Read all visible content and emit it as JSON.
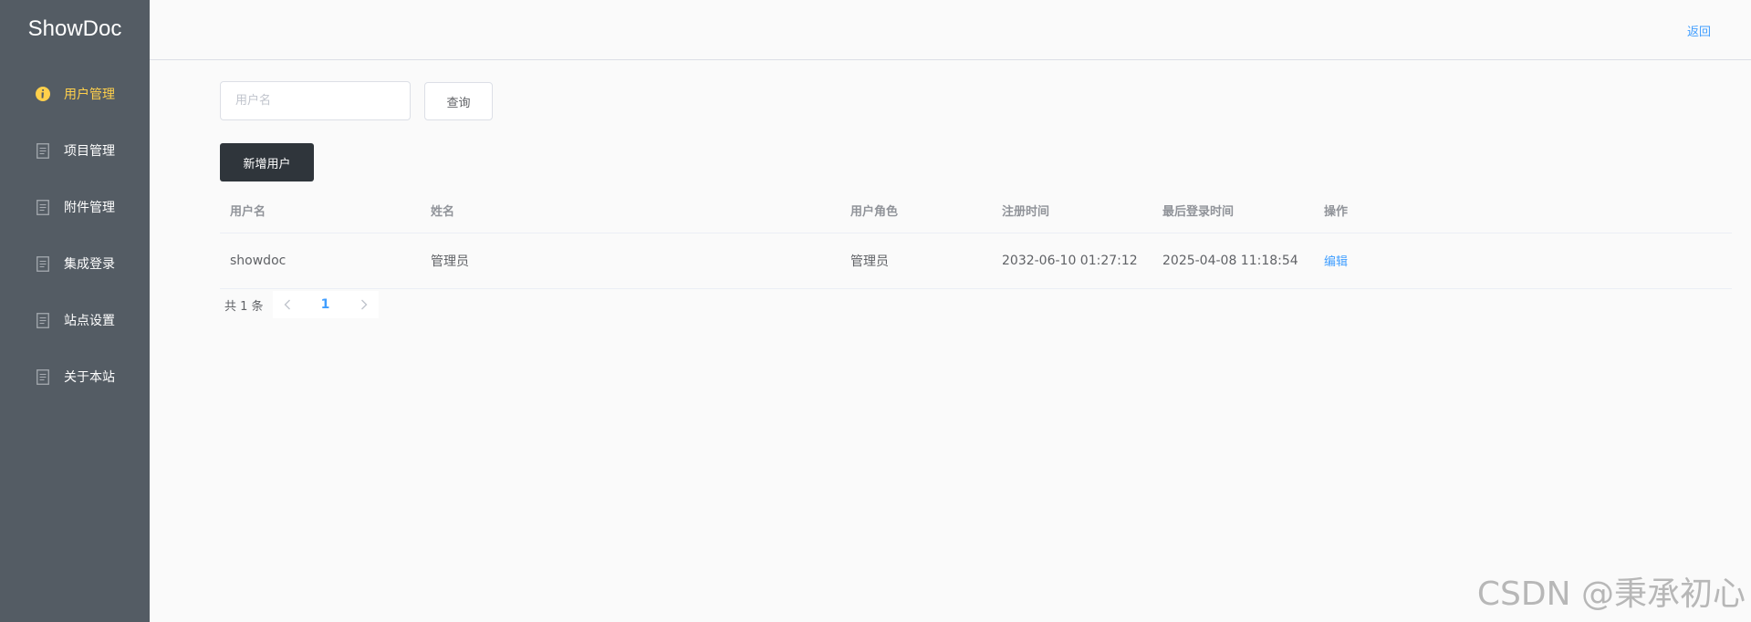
{
  "app": {
    "logo": "ShowDoc"
  },
  "sidebar": {
    "items": [
      {
        "label": "用户管理",
        "icon": "info-icon",
        "active": true
      },
      {
        "label": "项目管理",
        "icon": "document-icon",
        "active": false
      },
      {
        "label": "附件管理",
        "icon": "document-icon",
        "active": false
      },
      {
        "label": "集成登录",
        "icon": "document-icon",
        "active": false
      },
      {
        "label": "站点设置",
        "icon": "document-icon",
        "active": false
      },
      {
        "label": "关于本站",
        "icon": "document-icon",
        "active": false
      }
    ]
  },
  "header": {
    "back_label": "返回"
  },
  "search": {
    "placeholder": "用户名",
    "value": "",
    "query_label": "查询"
  },
  "toolbar": {
    "add_user_label": "新增用户"
  },
  "table": {
    "headers": [
      "用户名",
      "姓名",
      "用户角色",
      "注册时间",
      "最后登录时间",
      "操作"
    ],
    "rows": [
      {
        "username": "showdoc",
        "name": "管理员",
        "role": "管理员",
        "registered": "2032-06-10 01:27:12",
        "last_login": "2025-04-08 11:18:54",
        "action": "编辑"
      }
    ]
  },
  "pagination": {
    "total_text": "共 1 条",
    "current_page": "1",
    "prev_icon": "chevron-left-icon",
    "next_icon": "chevron-right-icon"
  },
  "watermark": "CSDN @秉承初心",
  "colors": {
    "sidebar_bg": "#545c64",
    "active_text": "#ffd04b",
    "accent": "#409eff",
    "dark_button": "#2f353b"
  }
}
